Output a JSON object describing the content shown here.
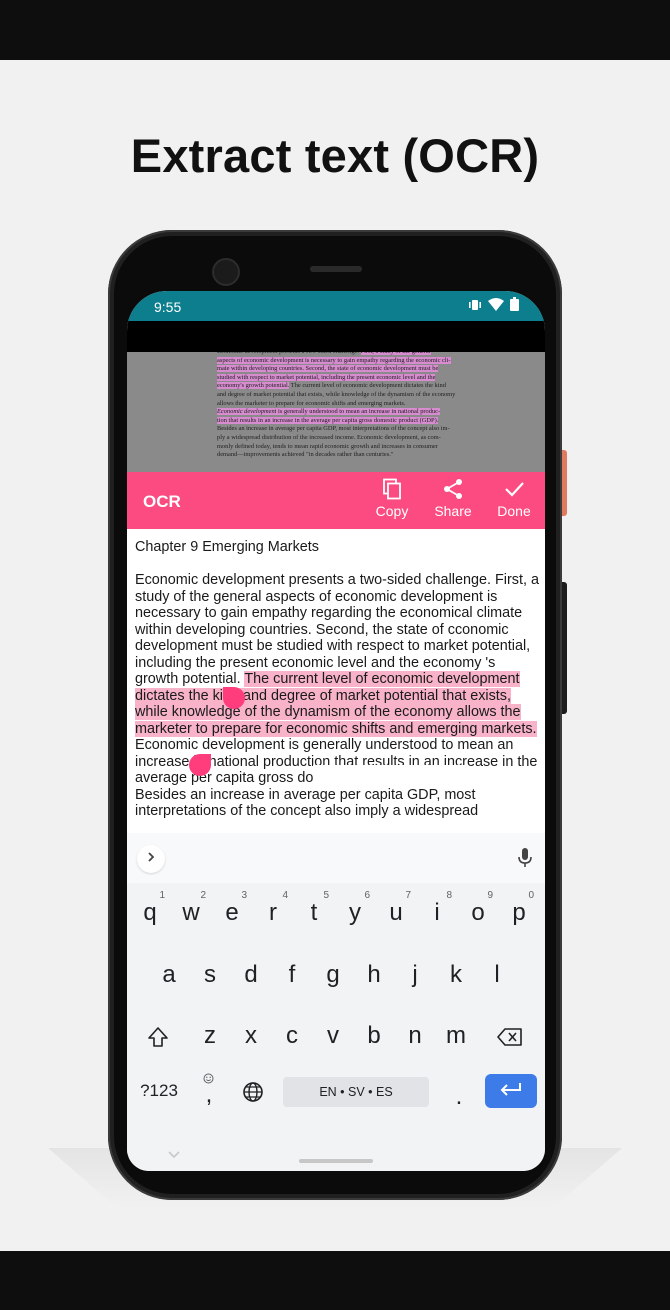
{
  "headline": "Extract text (OCR)",
  "status": {
    "time": "9:55"
  },
  "scan": {
    "lines": [
      {
        "segments": [
          {
            "t": "Economic development presents a two-sided challenge. ",
            "c": ""
          },
          {
            "t": "First, a study of the general",
            "c": "hl"
          }
        ]
      },
      {
        "segments": [
          {
            "t": "aspects of economic development is necessary to gain empathy regarding the economic cli-",
            "c": "hl"
          }
        ]
      },
      {
        "segments": [
          {
            "t": "mate within developing countries. Second, the state of economic development must be",
            "c": "hl"
          }
        ]
      },
      {
        "segments": [
          {
            "t": "studied with respect to market potential, including the present economic level and the",
            "c": "hl"
          }
        ]
      },
      {
        "segments": [
          {
            "t": "economy's growth potential.",
            "c": "hl"
          },
          {
            "t": " The current level of economic development dictates the kind",
            "c": ""
          }
        ]
      },
      {
        "segments": [
          {
            "t": "and degree of market potential that exists, while knowledge of the dynamism of the economy",
            "c": ""
          }
        ]
      },
      {
        "segments": [
          {
            "t": "allows the marketer to prepare for economic shifts and emerging markets.",
            "c": ""
          }
        ]
      },
      {
        "segments": [
          {
            "t": "    Economic development",
            "c": "hl it"
          },
          {
            "t": " is generally understood to mean an increase in national produc-",
            "c": "hl"
          }
        ]
      },
      {
        "segments": [
          {
            "t": "tion that results in an increase in the average per capita gross domestic product (GDP).",
            "c": "hl"
          }
        ]
      },
      {
        "segments": [
          {
            "t": "Besides an increase in average per capita GDP, most interpretations of the concept also im-",
            "c": ""
          }
        ]
      },
      {
        "segments": [
          {
            "t": "ply a widespread distribution of the increased income. Economic development, as com-",
            "c": ""
          }
        ]
      },
      {
        "segments": [
          {
            "t": "monly defined today, tends to mean rapid economic growth and increases in consumer",
            "c": ""
          }
        ]
      },
      {
        "segments": [
          {
            "t": "demand—improvements achieved \"in decades rather than centuries.\"",
            "c": ""
          }
        ]
      }
    ]
  },
  "toolbar": {
    "title": "OCR",
    "copy_label": "Copy",
    "share_label": "Share",
    "done_label": "Done"
  },
  "result": {
    "heading": "Chapter 9 Emerging Markets",
    "para1_plain": "Economic development presents a two-sided challenge. First, a study of the general aspects of economic development is necessary to gain empathy regarding the economical climate within developing countries. Second, the state of cconomic development must be studied with respect to market potential, including the present economic level and the economy 's growth potential. ",
    "para1_selected": "The current level of economic development dictates the kind and degree of market potential that exists, while knowledge of the dynamism of the economy allows the marketer to prepare for economic shifts and emerging markets.",
    "para2": "Economic development is generally understood to mean an increase in national production that results in an increase in the average per capita gross domestic product (GDP).",
    "para3": "Besides an increase in average per capita GDP, most interpretations of the concept also imply a widespread"
  },
  "keyboard": {
    "row1": [
      {
        "k": "q",
        "h": "1"
      },
      {
        "k": "w",
        "h": "2"
      },
      {
        "k": "e",
        "h": "3"
      },
      {
        "k": "r",
        "h": "4"
      },
      {
        "k": "t",
        "h": "5"
      },
      {
        "k": "y",
        "h": "6"
      },
      {
        "k": "u",
        "h": "7"
      },
      {
        "k": "i",
        "h": "8"
      },
      {
        "k": "o",
        "h": "9"
      },
      {
        "k": "p",
        "h": "0"
      }
    ],
    "row2": [
      "a",
      "s",
      "d",
      "f",
      "g",
      "h",
      "j",
      "k",
      "l"
    ],
    "row3": [
      "z",
      "x",
      "c",
      "v",
      "b",
      "n",
      "m"
    ],
    "symbols_label": "?123",
    "comma_label": ",",
    "period_label": ".",
    "space_label": "EN • SV • ES"
  },
  "colors": {
    "accent": "#fb4b81",
    "status_bar": "#0c7e8d",
    "selection": "#f8b3c9",
    "enter_key": "#3c7be8"
  },
  "icons": {
    "copy": "copy-icon",
    "share": "share-icon",
    "done": "check-icon",
    "mic": "mic-icon",
    "shift": "shift-icon",
    "backspace": "backspace-icon",
    "globe": "globe-icon",
    "emoji": "emoji-icon",
    "enter": "enter-icon"
  }
}
